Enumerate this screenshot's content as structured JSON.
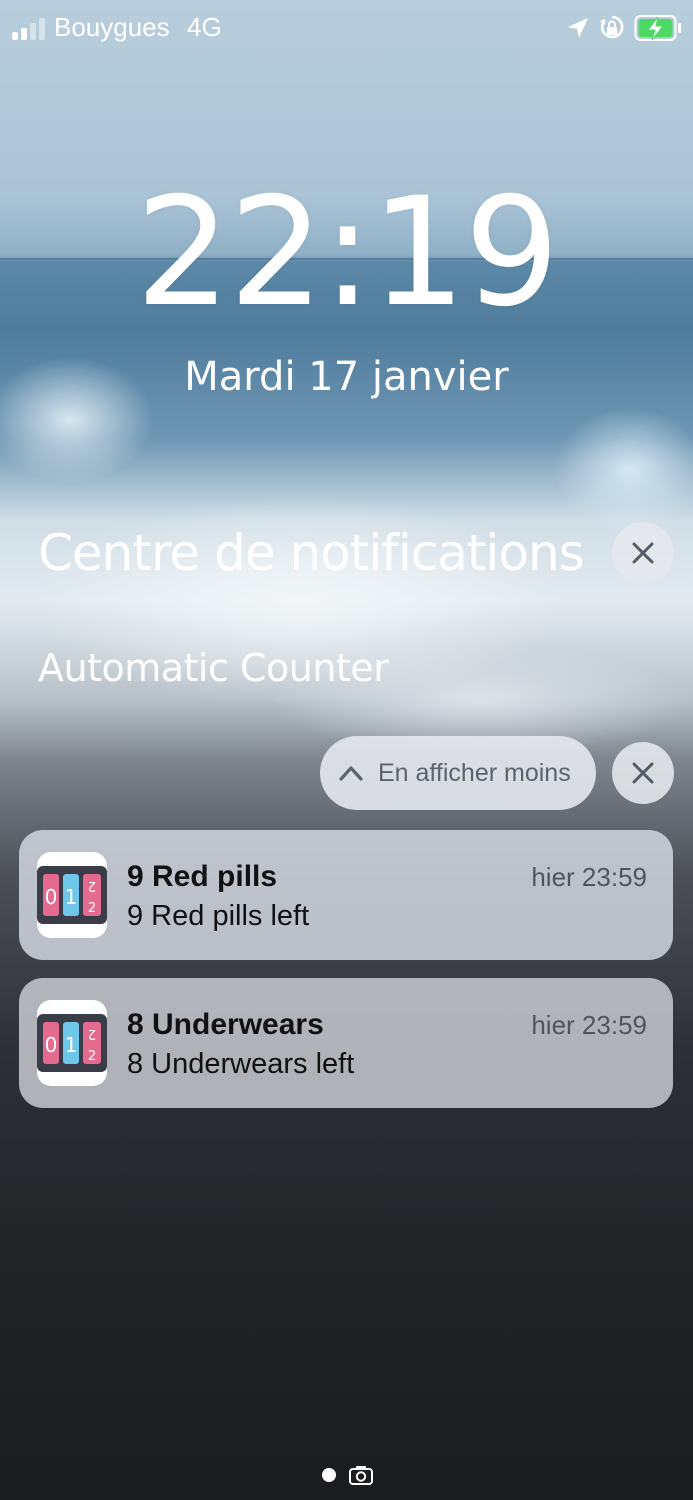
{
  "status_bar": {
    "carrier": "Bouygues",
    "network": "4G",
    "signal_bars_active": 2,
    "signal_bars_total": 4,
    "icons": [
      "signal-icon",
      "location-icon",
      "lock-rotation-icon",
      "battery-charging-icon"
    ],
    "battery_color": "#4cd964"
  },
  "lock_screen": {
    "time": "22:19",
    "date": "Mardi 17 janvier"
  },
  "notification_center": {
    "title": "Centre de notifications",
    "group": {
      "app_name": "Automatic Counter",
      "show_less_label": "En afficher moins",
      "notifications": [
        {
          "title": "9 Red pills",
          "body": "9 Red pills left",
          "time": "hier 23:59",
          "icon": "counter-app-icon"
        },
        {
          "title": "8 Underwears",
          "body": "8 Underwears left",
          "time": "hier 23:59",
          "icon": "counter-app-icon"
        }
      ]
    }
  },
  "pager": {
    "pages": 1,
    "current": 1,
    "extra_icon": "camera-icon"
  },
  "colors": {
    "app_icon_pink": "#e46a8e",
    "app_icon_blue": "#6ec6e8",
    "app_icon_frame": "#3a3d48"
  }
}
